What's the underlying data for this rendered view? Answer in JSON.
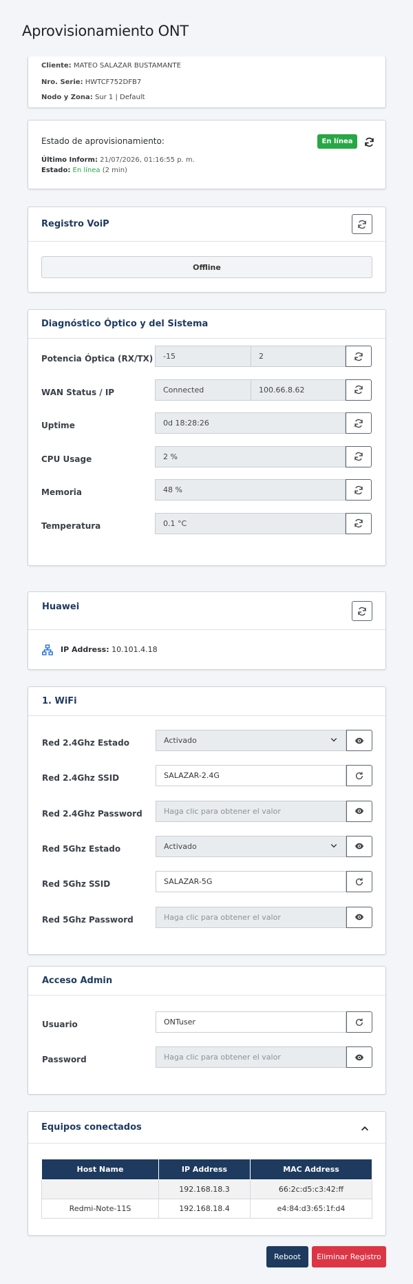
{
  "page_title": "Aprovisionamiento ONT",
  "info": {
    "cliente_label": "Cliente:",
    "cliente_value": "MATEO SALAZAR BUSTAMANTE",
    "serie_label": "Nro. Serie:",
    "serie_value": "HWTCF752DFB7",
    "nodo_label": "Nodo y Zona:",
    "nodo_value": "Sur 1 | Default"
  },
  "estado": {
    "title": "Estado de aprovisionamiento:",
    "badge": "En línea",
    "ultimo_label": "Último Inform:",
    "ultimo_value": "21/07/2026, 01:16:55 p. m.",
    "estado_label": "Estado:",
    "estado_value": "En línea",
    "estado_suffix": "(2 min)",
    "badge_color": "#28a745"
  },
  "voip": {
    "title": "Registro VoiP",
    "status": "Offline"
  },
  "diag": {
    "title": "Diagnóstico Óptico y del Sistema",
    "rows": [
      {
        "label": "Potencia Óptica (RX/TX)",
        "v1": "-15",
        "v2": "2"
      },
      {
        "label": "WAN Status / IP",
        "v1": "Connected",
        "v2": "100.66.8.62"
      },
      {
        "label": "Uptime",
        "v1": "0d 18:28:26"
      },
      {
        "label": "CPU Usage",
        "v1": "2 %"
      },
      {
        "label": "Memoria",
        "v1": "48 %"
      },
      {
        "label": "Temperatura",
        "v1": "0.1 °C"
      }
    ]
  },
  "huawei": {
    "title": "Huawei",
    "ip_label": "IP Address:",
    "ip_value": "10.101.4.18"
  },
  "wifi": {
    "title": "1. WiFi",
    "rows": [
      {
        "label": "Red 2.4Ghz Estado",
        "value": "Activado"
      },
      {
        "label": "Red 2.4Ghz SSID",
        "value": "SALAZAR-2.4G"
      },
      {
        "label": "Red 2.4Ghz Password",
        "placeholder": "Haga clic para obtener el valor"
      },
      {
        "label": "Red 5Ghz Estado",
        "value": "Activado"
      },
      {
        "label": "Red 5Ghz SSID",
        "value": "SALAZAR-5G"
      },
      {
        "label": "Red 5Ghz Password",
        "placeholder": "Haga clic para obtener el valor"
      }
    ]
  },
  "admin": {
    "title": "Acceso Admin",
    "usuario_label": "Usuario",
    "usuario_value": "ONTuser",
    "password_label": "Password",
    "password_placeholder": "Haga clic para obtener el valor"
  },
  "equipos": {
    "title": "Equipos conectados",
    "headers": [
      "Host Name",
      "IP Address",
      "MAC Address"
    ],
    "rows": [
      [
        "",
        "192.168.18.3",
        "66:2c:d5:c3:42:ff"
      ],
      [
        "Redmi-Note-11S",
        "192.168.18.4",
        "e4:84:d3:65:1f:d4"
      ]
    ]
  },
  "actions": {
    "reboot": "Reboot",
    "delete": "Eliminar Registro",
    "reboot_color": "#1e3a5f",
    "delete_color": "#dc3545"
  }
}
